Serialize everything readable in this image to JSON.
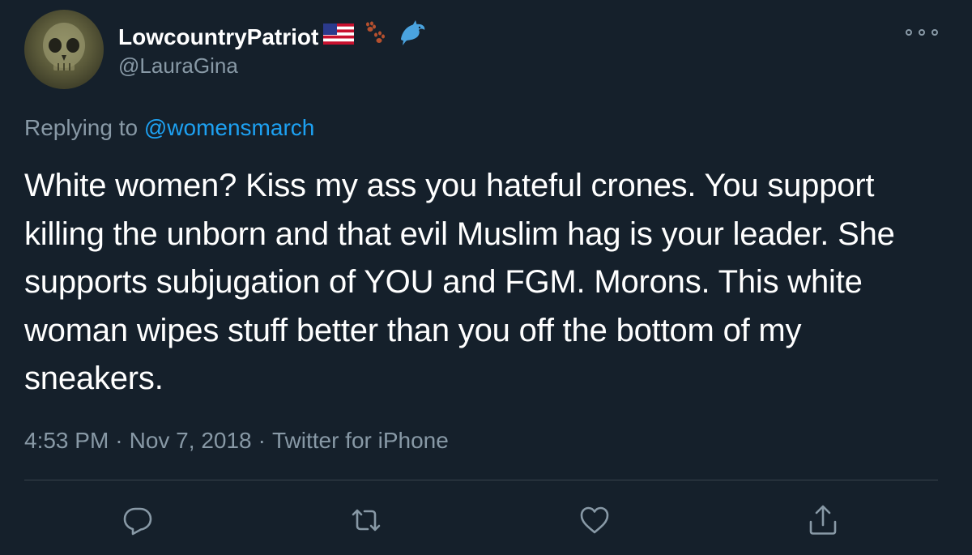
{
  "tweet": {
    "display_name": "LowcountryPatriot",
    "name_emojis": [
      "us-flag-icon",
      "paw-prints-icon",
      "dolphin-icon"
    ],
    "handle": "@LauraGina",
    "replying_prefix": "Replying to",
    "replying_to": "@womensmarch",
    "text": "White women? Kiss my ass you hateful crones. You support killing the unborn and that evil Muslim hag is your leader. She supports subjugation of YOU and FGM. Morons. This white woman wipes stuff better than you off the bottom of my sneakers.",
    "time": "4:53 PM",
    "date": "Nov 7, 2018",
    "separator": "·",
    "source": "Twitter for iPhone"
  },
  "actions": [
    "reply-icon",
    "retweet-icon",
    "like-icon",
    "share-icon"
  ],
  "colors": {
    "background": "#15202b",
    "text": "#ffffff",
    "secondary": "#8899a6",
    "link": "#1da1f2",
    "divider": "#38444d"
  }
}
